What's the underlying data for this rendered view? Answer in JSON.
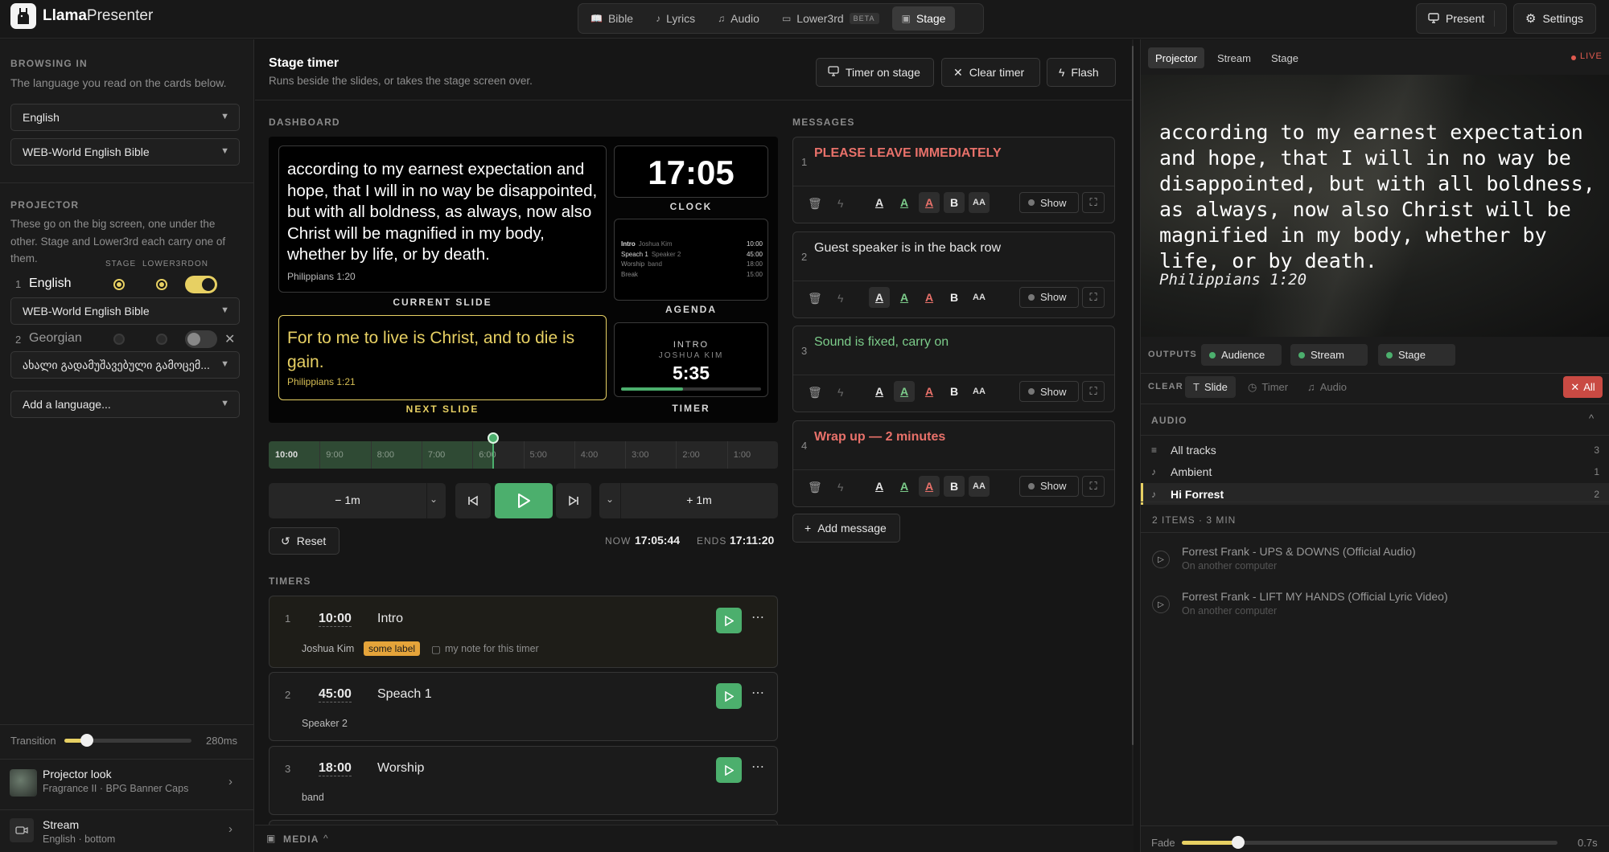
{
  "app": {
    "name_bold": "Llama",
    "name_rest": "Presenter"
  },
  "nav": {
    "tabs": [
      {
        "label": "Bible",
        "icon": "book-icon"
      },
      {
        "label": "Lyrics",
        "icon": "music-note-icon"
      },
      {
        "label": "Audio",
        "icon": "music-icon"
      },
      {
        "label": "Lower3rd",
        "icon": "lower-third-icon",
        "badge": "BETA"
      },
      {
        "label": "Stage",
        "icon": "monitor-icon",
        "active": true
      }
    ],
    "present": "Present",
    "settings": "Settings"
  },
  "left": {
    "browsing_title": "BROWSING IN",
    "browsing_desc": "The language you read on the cards below.",
    "language": "English",
    "bible": "WEB-World English Bible",
    "projector_title": "PROJECTOR",
    "projector_desc": "These go on the big screen, one under the other. Stage and Lower3rd each carry one of them.",
    "col_stage": "STAGE",
    "col_lower3rd": "LOWER3RD",
    "col_on": "ON",
    "languages": [
      {
        "num": "1",
        "name": "English",
        "bible": "WEB-World English Bible",
        "stage": true,
        "lower3rd": true,
        "on": true
      },
      {
        "num": "2",
        "name": "Georgian",
        "bible": "ახალი გადამუშავებული გამოცემ...",
        "stage": false,
        "lower3rd": false,
        "on": false
      }
    ],
    "add_language": "Add a language...",
    "transition_label": "Transition",
    "transition_value": "280ms",
    "transition_fraction": 0.18,
    "projector_look_title": "Projector look",
    "projector_look_sub": "Fragrance II · BPG Banner Caps",
    "stream_title": "Stream",
    "stream_sub": "English · bottom"
  },
  "stage": {
    "title": "Stage timer",
    "subtitle": "Runs beside the slides, or takes the stage screen over.",
    "timer_on_stage": "Timer on stage",
    "clear_timer": "Clear timer",
    "flash": "Flash",
    "dashboard_label": "DASHBOARD",
    "current_slide_text": "according to my earnest expectation and hope, that I will in no way be disappointed, but with all boldness, as always, now also Christ will be magnified in my body, whether by life, or by death.",
    "current_slide_ref": "Philippians 1:20",
    "current_slide_caption": "CURRENT SLIDE",
    "next_slide_text": "For to me to live is Christ, and to die is gain.",
    "next_slide_ref": "Philippians 1:21",
    "next_slide_caption": "NEXT SLIDE",
    "clock_time": "17:05",
    "clock_caption": "CLOCK",
    "agenda_caption": "AGENDA",
    "agenda": [
      {
        "title": "Intro",
        "who": "Joshua Kim",
        "time": "10:00"
      },
      {
        "title": "Speach 1",
        "who": "Speaker 2",
        "time": "45:00"
      },
      {
        "title": "Worship",
        "who": "band",
        "time": "18:00"
      },
      {
        "title": "Break",
        "who": "",
        "time": "15:00"
      }
    ],
    "timer_box_label": "INTRO",
    "timer_box_who": "JOSHUA KIM",
    "timer_box_time": "5:35",
    "timer_box_progress": 0.44,
    "timer_caption": "TIMER",
    "scale": [
      "10:00",
      "9:00",
      "8:00",
      "7:00",
      "6:00",
      "5:00",
      "4:00",
      "3:00",
      "2:00",
      "1:00"
    ],
    "elapsed_fraction": 0.44,
    "minus": "1m",
    "plus": "1m",
    "reset": "Reset",
    "now_label": "NOW",
    "now_value": "17:05:44",
    "ends_label": "ENDS",
    "ends_value": "17:11:20",
    "timers_label": "TIMERS",
    "timers": [
      {
        "num": "1",
        "duration": "10:00",
        "name": "Intro",
        "who": "Joshua Kim",
        "tag": "some label",
        "note": "my note for this timer",
        "active": true
      },
      {
        "num": "2",
        "duration": "45:00",
        "name": "Speach 1",
        "who": "Speaker 2"
      },
      {
        "num": "3",
        "duration": "18:00",
        "name": "Worship",
        "who": "band"
      }
    ],
    "media_label": "MEDIA"
  },
  "messages": {
    "label": "MESSAGES",
    "items": [
      {
        "num": "1",
        "text": "PLEASE LEAVE IMMEDIATELY",
        "color": "#e8716a",
        "bold": true,
        "sel": 3
      },
      {
        "num": "2",
        "text": "Guest speaker is in the back row",
        "color": "#e6e6e6",
        "bold": false,
        "sel": 1
      },
      {
        "num": "3",
        "text": "Sound is fixed, carry on",
        "color": "#7ccc8a",
        "bold": false,
        "sel": 2
      },
      {
        "num": "4",
        "text": "Wrap up — 2 minutes",
        "color": "#e8716a",
        "bold": true,
        "sel": 3
      }
    ],
    "show": "Show",
    "add": "Add message"
  },
  "right": {
    "tabs": [
      "Projector",
      "Stream",
      "Stage"
    ],
    "live": "LIVE",
    "preview_text": "according to my earnest expectation and hope, that I will in no way be disappointed, but with all boldness, as always, now also Christ will be magnified in my body, whether by life, or by death.",
    "preview_ref": "Philippians 1:20",
    "outputs_label": "OUTPUTS",
    "outputs": [
      "Audience",
      "Stream",
      "Stage"
    ],
    "clear_label": "CLEAR",
    "clear_items": [
      "Slide",
      "Timer",
      "Audio"
    ],
    "clear_all": "All",
    "audio_label": "AUDIO",
    "audio_rows": [
      {
        "label": "All tracks",
        "count": "3"
      },
      {
        "label": "Ambient",
        "count": "1"
      },
      {
        "label": "Hi Forrest",
        "count": "2",
        "active": true
      }
    ],
    "items_summary": "2 ITEMS · 3 MIN",
    "tracks": [
      {
        "title": "Forrest Frank - UPS & DOWNS (Official Audio)",
        "sub": "On another computer"
      },
      {
        "title": "Forrest Frank - LIFT MY HANDS (Official Lyric Video)",
        "sub": "On another computer"
      }
    ],
    "fade_label": "Fade",
    "fade_value": "0.7s",
    "fade_fraction": 0.15
  },
  "colors": {
    "accent": "#e7d063",
    "green": "#4caf6d",
    "red": "#d9534f"
  }
}
